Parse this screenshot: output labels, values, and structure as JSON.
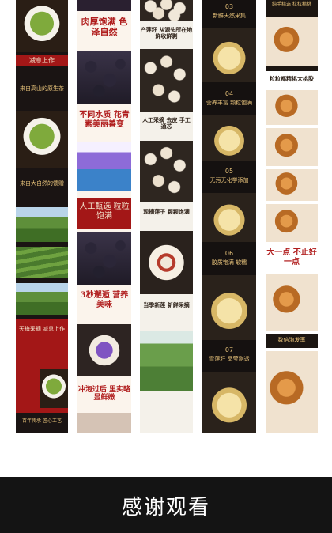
{
  "strip1": {
    "tag": "减息上作",
    "line1": "来自高山的原生茶",
    "line2": "来自大自然的馈赠",
    "badge": "天梅采摘 减息上作",
    "tail": "百年传承 匠心工艺"
  },
  "strip2": {
    "h1": "肉厚饱满 色泽自然",
    "h2": "不同水质 花青素美丽善变",
    "h3": "人工甄选 粒粒饱满",
    "h4": "3秒邂逅 营养美味",
    "h5": "冲泡过后 里实略显鲜嫩"
  },
  "strip3": {
    "t1": "产莲籽 从源头所在地 鲜收鲜剥",
    "t2": "人工采摘 去皮 手工通芯",
    "t3": "现摘莲子 颗颗饱满",
    "t4": "当季新莲 新鲜采摘"
  },
  "strip4": {
    "n1": "03",
    "c1": "新鲜天然采集",
    "n2": "04",
    "c2": "营养丰富 颗粒饱满",
    "n3": "05",
    "c3": "无污无化学添加",
    "n4": "06",
    "c4": "胶质饱满 软糯",
    "n5": "07",
    "c5": "雪莲籽 晶莹剔透"
  },
  "strip5": {
    "top": "纯手精选 粒粒精挑",
    "mid": "粒粒都精挑大桃胶",
    "big": "大一点 不止好一点",
    "bottom": "数倍泡发率"
  },
  "footer": {
    "text": "感谢观看"
  }
}
